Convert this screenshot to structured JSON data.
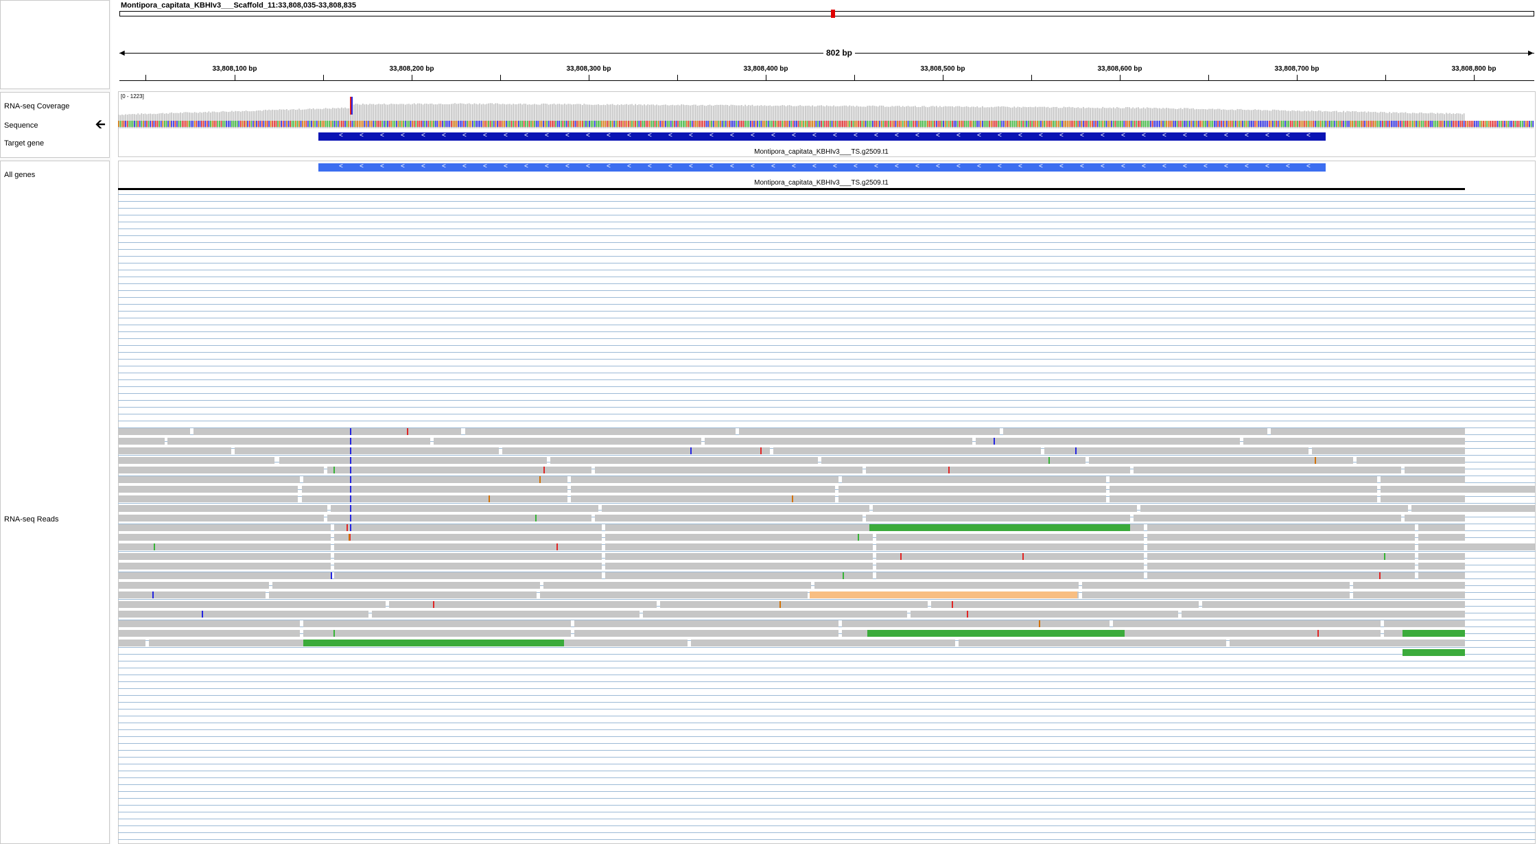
{
  "locus": {
    "title": "Montipora_capitata_KBHIv3___Scaffold_11:33,808,035-33,808,835"
  },
  "ruler": {
    "span_label": "802 bp",
    "ticks": [
      "33,808,100 bp",
      "33,808,200 bp",
      "33,808,300 bp",
      "33,808,400 bp",
      "33,808,500 bp",
      "33,808,600 bp",
      "33,808,700 bp",
      "33,808,800 bp"
    ]
  },
  "tracks": {
    "coverage": {
      "name": "RNA-seq Coverage",
      "range": "[0 - 1223]",
      "color": "#c0c0c0"
    },
    "sequence": {
      "name": "Sequence",
      "strand_arrow": "arrow-left-icon"
    },
    "target_gene": {
      "name": "Target gene",
      "feature": "Montipora_capitata_KBHIv3___TS.g2509.t1",
      "color": "#0a14b4"
    },
    "all_genes": {
      "name": "All genes",
      "feature": "Montipora_capitata_KBHIv3___TS.g2509.t1",
      "color": "#3c6ef0"
    },
    "reads": {
      "name": "RNA-seq Reads",
      "color": "#c6c6c6"
    }
  },
  "colors": {
    "base_A": "#36b336",
    "base_C": "#2424e0",
    "base_G": "#d17105",
    "base_T": "#e02424",
    "splice_line": "#9cbad6",
    "junction_green": "#3bab3b",
    "junction_orange": "#f8be82"
  }
}
